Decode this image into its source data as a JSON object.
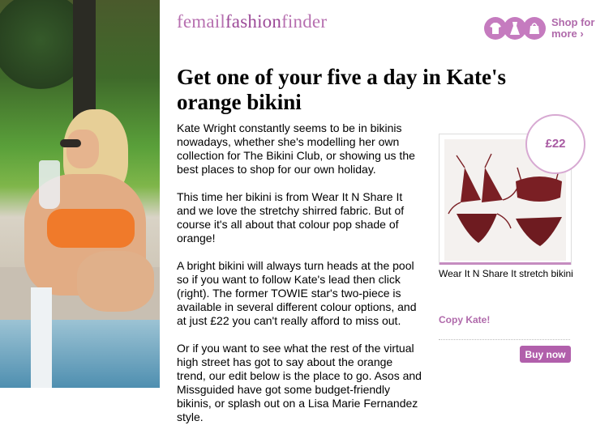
{
  "header": {
    "logo_part1": "femail",
    "logo_part2": "fashion",
    "logo_part3": "finder",
    "shop_for_more_line1": "Shop for",
    "shop_for_more_line2": "more ›"
  },
  "headline": "Get one of your five a day in Kate's orange bikini",
  "paragraphs": [
    "Kate Wright constantly seems to be in bikinis nowadays, whether she's modelling her own collection for The Bikini Club, or showing us the best places to shop for our own holiday.",
    "This time her bikini is from Wear It N Share It and we love the stretchy shirred fabric. But of course it's all about that colour pop shade of orange!",
    "A bright bikini will always turn heads at the pool so if you want to follow Kate's lead then click (right). The former TOWIE star's two-piece is available in several different colour options, and at just £22 you can't really afford to miss out.",
    "Or if you want to see what the rest of the virtual high street has got to say about the orange trend, our edit below is the place to go. Asos and Missguided have got some budget-friendly bikinis, or splash out on a Lisa Marie Fernandez style."
  ],
  "product": {
    "price": "£22",
    "caption": "Wear It N Share It stretch bikini",
    "copy_label": "Copy Kate!",
    "buy_label": "Buy now"
  },
  "colors": {
    "brand": "#b06aab",
    "bikini_product": "#7a1f24",
    "bikini_photo": "#f07a2a"
  },
  "icons": [
    "shirt-icon",
    "dress-icon",
    "bag-icon"
  ]
}
